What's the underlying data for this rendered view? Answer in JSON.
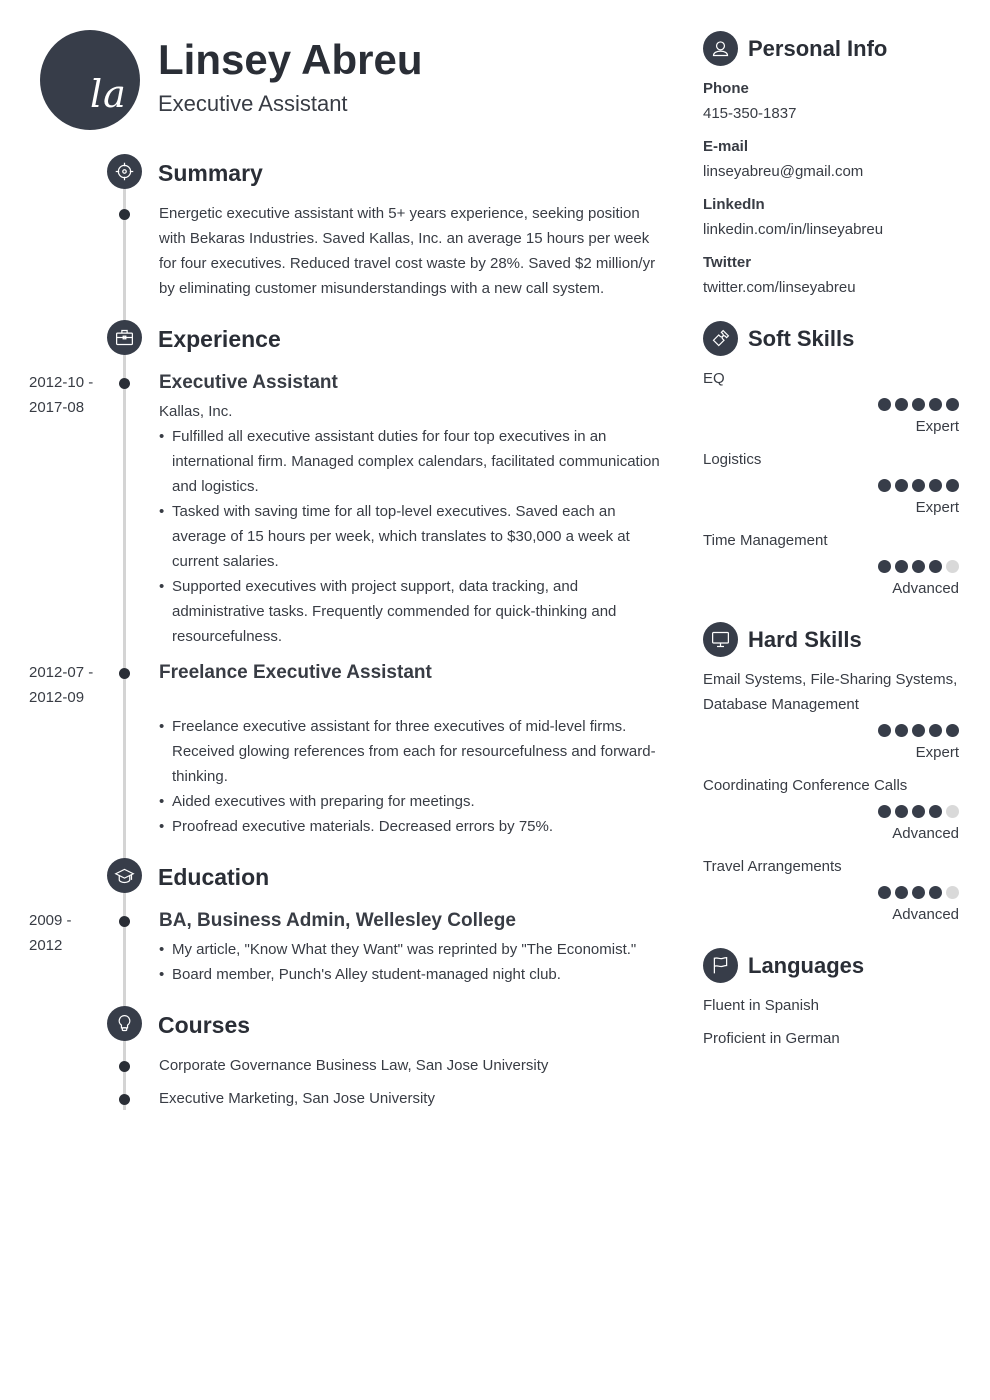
{
  "header": {
    "initials": "la",
    "name": "Linsey Abreu",
    "title": "Executive Assistant"
  },
  "summary": {
    "title": "Summary",
    "icon": "target-icon",
    "text": "Energetic executive assistant with 5+ years experience, seeking position with Bekaras Industries. Saved Kallas, Inc. an average 15 hours per week for four executives. Reduced travel cost waste by 28%. Saved $2 million/yr by eliminating customer misunderstandings with a new call system."
  },
  "experience": {
    "title": "Experience",
    "icon": "briefcase-icon",
    "items": [
      {
        "date_start": "2012-10 -",
        "date_end": "2017-08",
        "title": "Executive Assistant",
        "company": "Kallas, Inc.",
        "bullets": [
          "Fulfilled all executive assistant duties for four top executives in an international firm. Managed complex calendars, facilitated communication and logistics.",
          "Tasked with saving time for all top-level executives. Saved each an average of 15 hours per week, which translates to $30,000 a week at current salaries.",
          "Supported executives with project support, data tracking, and administrative tasks. Frequently commended for quick-thinking and resourcefulness."
        ]
      },
      {
        "date_start": "2012-07 -",
        "date_end": "2012-09",
        "title": "Freelance Executive Assistant",
        "company": "",
        "bullets": [
          "Freelance executive assistant for three executives of mid-level firms. Received glowing references from each for resourcefulness and forward-thinking.",
          "Aided executives with preparing for meetings.",
          "Proofread executive materials. Decreased errors by 75%."
        ]
      }
    ]
  },
  "education": {
    "title": "Education",
    "icon": "graduation-cap-icon",
    "items": [
      {
        "date_start": "2009 -",
        "date_end": "2012",
        "title": "BA, Business Admin, Wellesley College",
        "bullets": [
          "My article, \"Know What they Want\" was reprinted by \"The Economist.\"",
          "Board member, Punch's Alley student-managed night club."
        ]
      }
    ]
  },
  "courses": {
    "title": "Courses",
    "icon": "lightbulb-icon",
    "items": [
      "Corporate Governance Business Law, San Jose University",
      "Executive Marketing, San Jose University"
    ]
  },
  "personal_info": {
    "title": "Personal Info",
    "icon": "user-icon",
    "fields": [
      {
        "label": "Phone",
        "value": "415-350-1837"
      },
      {
        "label": "E-mail",
        "value": "linseyabreu@gmail.com"
      },
      {
        "label": "LinkedIn",
        "value": "linkedin.com/in/linseyabreu"
      },
      {
        "label": "Twitter",
        "value": "twitter.com/linseyabreu"
      }
    ]
  },
  "soft_skills": {
    "title": "Soft Skills",
    "icon": "puzzle-icon",
    "items": [
      {
        "name": "EQ",
        "rating": 5,
        "max": 5,
        "level": "Expert"
      },
      {
        "name": "Logistics",
        "rating": 5,
        "max": 5,
        "level": "Expert"
      },
      {
        "name": "Time Management",
        "rating": 4,
        "max": 5,
        "level": "Advanced"
      }
    ]
  },
  "hard_skills": {
    "title": "Hard Skills",
    "icon": "monitor-icon",
    "items": [
      {
        "name": "Email Systems, File-Sharing Systems, Database Management",
        "rating": 5,
        "max": 5,
        "level": "Expert"
      },
      {
        "name": "Coordinating Conference Calls",
        "rating": 4,
        "max": 5,
        "level": "Advanced"
      },
      {
        "name": "Travel Arrangements",
        "rating": 4,
        "max": 5,
        "level": "Advanced"
      }
    ]
  },
  "languages": {
    "title": "Languages",
    "icon": "flag-icon",
    "items": [
      "Fluent in Spanish",
      "Proficient in German"
    ]
  },
  "colors": {
    "accent": "#373d49",
    "text": "#383c44",
    "heading": "#2a2e36",
    "timeline": "#d4d4d4",
    "dot_off": "#d9d9d9"
  }
}
